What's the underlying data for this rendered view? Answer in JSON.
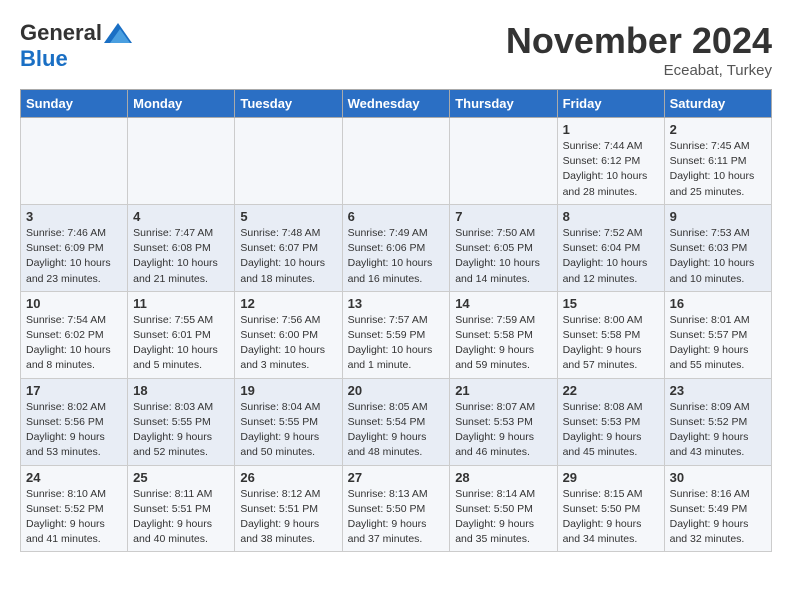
{
  "logo": {
    "general": "General",
    "blue": "Blue"
  },
  "header": {
    "month": "November 2024",
    "location": "Eceabat, Turkey"
  },
  "weekdays": [
    "Sunday",
    "Monday",
    "Tuesday",
    "Wednesday",
    "Thursday",
    "Friday",
    "Saturday"
  ],
  "weeks": [
    [
      {
        "day": "",
        "info": ""
      },
      {
        "day": "",
        "info": ""
      },
      {
        "day": "",
        "info": ""
      },
      {
        "day": "",
        "info": ""
      },
      {
        "day": "",
        "info": ""
      },
      {
        "day": "1",
        "info": "Sunrise: 7:44 AM\nSunset: 6:12 PM\nDaylight: 10 hours and 28 minutes."
      },
      {
        "day": "2",
        "info": "Sunrise: 7:45 AM\nSunset: 6:11 PM\nDaylight: 10 hours and 25 minutes."
      }
    ],
    [
      {
        "day": "3",
        "info": "Sunrise: 7:46 AM\nSunset: 6:09 PM\nDaylight: 10 hours and 23 minutes."
      },
      {
        "day": "4",
        "info": "Sunrise: 7:47 AM\nSunset: 6:08 PM\nDaylight: 10 hours and 21 minutes."
      },
      {
        "day": "5",
        "info": "Sunrise: 7:48 AM\nSunset: 6:07 PM\nDaylight: 10 hours and 18 minutes."
      },
      {
        "day": "6",
        "info": "Sunrise: 7:49 AM\nSunset: 6:06 PM\nDaylight: 10 hours and 16 minutes."
      },
      {
        "day": "7",
        "info": "Sunrise: 7:50 AM\nSunset: 6:05 PM\nDaylight: 10 hours and 14 minutes."
      },
      {
        "day": "8",
        "info": "Sunrise: 7:52 AM\nSunset: 6:04 PM\nDaylight: 10 hours and 12 minutes."
      },
      {
        "day": "9",
        "info": "Sunrise: 7:53 AM\nSunset: 6:03 PM\nDaylight: 10 hours and 10 minutes."
      }
    ],
    [
      {
        "day": "10",
        "info": "Sunrise: 7:54 AM\nSunset: 6:02 PM\nDaylight: 10 hours and 8 minutes."
      },
      {
        "day": "11",
        "info": "Sunrise: 7:55 AM\nSunset: 6:01 PM\nDaylight: 10 hours and 5 minutes."
      },
      {
        "day": "12",
        "info": "Sunrise: 7:56 AM\nSunset: 6:00 PM\nDaylight: 10 hours and 3 minutes."
      },
      {
        "day": "13",
        "info": "Sunrise: 7:57 AM\nSunset: 5:59 PM\nDaylight: 10 hours and 1 minute."
      },
      {
        "day": "14",
        "info": "Sunrise: 7:59 AM\nSunset: 5:58 PM\nDaylight: 9 hours and 59 minutes."
      },
      {
        "day": "15",
        "info": "Sunrise: 8:00 AM\nSunset: 5:58 PM\nDaylight: 9 hours and 57 minutes."
      },
      {
        "day": "16",
        "info": "Sunrise: 8:01 AM\nSunset: 5:57 PM\nDaylight: 9 hours and 55 minutes."
      }
    ],
    [
      {
        "day": "17",
        "info": "Sunrise: 8:02 AM\nSunset: 5:56 PM\nDaylight: 9 hours and 53 minutes."
      },
      {
        "day": "18",
        "info": "Sunrise: 8:03 AM\nSunset: 5:55 PM\nDaylight: 9 hours and 52 minutes."
      },
      {
        "day": "19",
        "info": "Sunrise: 8:04 AM\nSunset: 5:55 PM\nDaylight: 9 hours and 50 minutes."
      },
      {
        "day": "20",
        "info": "Sunrise: 8:05 AM\nSunset: 5:54 PM\nDaylight: 9 hours and 48 minutes."
      },
      {
        "day": "21",
        "info": "Sunrise: 8:07 AM\nSunset: 5:53 PM\nDaylight: 9 hours and 46 minutes."
      },
      {
        "day": "22",
        "info": "Sunrise: 8:08 AM\nSunset: 5:53 PM\nDaylight: 9 hours and 45 minutes."
      },
      {
        "day": "23",
        "info": "Sunrise: 8:09 AM\nSunset: 5:52 PM\nDaylight: 9 hours and 43 minutes."
      }
    ],
    [
      {
        "day": "24",
        "info": "Sunrise: 8:10 AM\nSunset: 5:52 PM\nDaylight: 9 hours and 41 minutes."
      },
      {
        "day": "25",
        "info": "Sunrise: 8:11 AM\nSunset: 5:51 PM\nDaylight: 9 hours and 40 minutes."
      },
      {
        "day": "26",
        "info": "Sunrise: 8:12 AM\nSunset: 5:51 PM\nDaylight: 9 hours and 38 minutes."
      },
      {
        "day": "27",
        "info": "Sunrise: 8:13 AM\nSunset: 5:50 PM\nDaylight: 9 hours and 37 minutes."
      },
      {
        "day": "28",
        "info": "Sunrise: 8:14 AM\nSunset: 5:50 PM\nDaylight: 9 hours and 35 minutes."
      },
      {
        "day": "29",
        "info": "Sunrise: 8:15 AM\nSunset: 5:50 PM\nDaylight: 9 hours and 34 minutes."
      },
      {
        "day": "30",
        "info": "Sunrise: 8:16 AM\nSunset: 5:49 PM\nDaylight: 9 hours and 32 minutes."
      }
    ]
  ]
}
